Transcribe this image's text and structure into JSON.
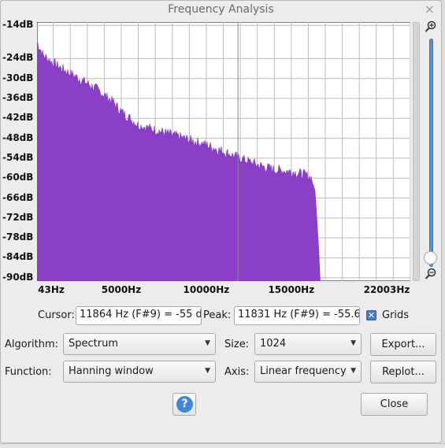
{
  "window": {
    "title": "Frequency Analysis",
    "close_glyph": "×"
  },
  "chart_data": {
    "type": "area",
    "title": "",
    "xlabel": "",
    "ylabel": "",
    "x_unit": "Hz",
    "y_unit": "dB",
    "xlim": [
      43,
      22003
    ],
    "ylim": [
      -91,
      -13
    ],
    "grid": true,
    "fill_color": "#8b3fc6",
    "x_tick_labels": [
      {
        "value": 43,
        "label": "43Hz"
      },
      {
        "value": 5000,
        "label": "5000Hz"
      },
      {
        "value": 10000,
        "label": "10000Hz"
      },
      {
        "value": 15000,
        "label": "15000Hz"
      },
      {
        "value": 22003,
        "label": "22003Hz"
      }
    ],
    "y_tick_labels": [
      {
        "value": -14,
        "label": "-14dB"
      },
      {
        "value": -24,
        "label": "-24dB"
      },
      {
        "value": -30,
        "label": "-30dB"
      },
      {
        "value": -36,
        "label": "-36dB"
      },
      {
        "value": -42,
        "label": "-42dB"
      },
      {
        "value": -48,
        "label": "-48dB"
      },
      {
        "value": -54,
        "label": "-54dB"
      },
      {
        "value": -60,
        "label": "-60dB"
      },
      {
        "value": -66,
        "label": "-66dB"
      },
      {
        "value": -72,
        "label": "-72dB"
      },
      {
        "value": -78,
        "label": "-78dB"
      },
      {
        "value": -84,
        "label": "-84dB"
      },
      {
        "value": -90,
        "label": "-90dB"
      }
    ],
    "points": [
      {
        "x": 43,
        "y": -19
      },
      {
        "x": 400,
        "y": -23
      },
      {
        "x": 900,
        "y": -25
      },
      {
        "x": 1500,
        "y": -27
      },
      {
        "x": 2000,
        "y": -28.5
      },
      {
        "x": 2500,
        "y": -30
      },
      {
        "x": 3000,
        "y": -31.5
      },
      {
        "x": 3500,
        "y": -33
      },
      {
        "x": 4000,
        "y": -35
      },
      {
        "x": 4500,
        "y": -37
      },
      {
        "x": 5000,
        "y": -40
      },
      {
        "x": 5500,
        "y": -42
      },
      {
        "x": 6000,
        "y": -44
      },
      {
        "x": 7000,
        "y": -45.5
      },
      {
        "x": 8000,
        "y": -47
      },
      {
        "x": 9000,
        "y": -48.5
      },
      {
        "x": 10000,
        "y": -50
      },
      {
        "x": 11000,
        "y": -52
      },
      {
        "x": 12000,
        "y": -54
      },
      {
        "x": 13000,
        "y": -56
      },
      {
        "x": 14000,
        "y": -57.5
      },
      {
        "x": 15000,
        "y": -58
      },
      {
        "x": 15800,
        "y": -59
      },
      {
        "x": 16200,
        "y": -60
      },
      {
        "x": 16400,
        "y": -64
      },
      {
        "x": 16600,
        "y": -80
      },
      {
        "x": 16700,
        "y": -91
      }
    ]
  },
  "cursor": {
    "label": "Cursor:",
    "value": "11864 Hz (F#9) = -55 d"
  },
  "peak": {
    "label": "Peak:",
    "value": "11831 Hz (F#9) = -55.6"
  },
  "grids": {
    "label": "Grids",
    "checked": true,
    "check_glyph": "✕"
  },
  "algorithm": {
    "label": "Algorithm:",
    "value": "Spectrum"
  },
  "size": {
    "label": "Size:",
    "value": "1024"
  },
  "function": {
    "label": "Function:",
    "value": "Hanning window"
  },
  "axis": {
    "label": "Axis:",
    "value": "Linear frequency"
  },
  "buttons": {
    "export": "Export...",
    "replot": "Replot...",
    "close": "Close",
    "help": "?"
  },
  "icons": {
    "zoom_in": "zoom-in-icon",
    "zoom_out": "zoom-out-icon",
    "dropdown": "chevron-down-icon",
    "help": "help-icon"
  }
}
